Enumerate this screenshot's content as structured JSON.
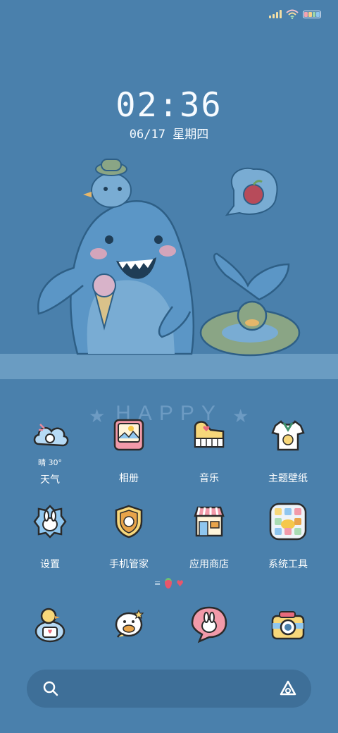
{
  "status_bar": {
    "icons": [
      "signal-icon",
      "wifi-icon",
      "battery-icon"
    ],
    "battery_colors": [
      "#f4a3b0",
      "#f6d08a",
      "#9fd6a8",
      "#8fc6ef"
    ]
  },
  "lockscreen": {
    "time": "02:36",
    "date": "06/17 星期四"
  },
  "wallpaper": {
    "text": "HAPPY",
    "background": "#4a80ac",
    "shark_color": "#5b96c6",
    "outline_color": "#2e5f86"
  },
  "apps": {
    "row1": [
      {
        "label": "天气",
        "icon": "weather-cloud-icon",
        "temp": "晴 30°"
      },
      {
        "label": "相册",
        "icon": "gallery-photo-icon"
      },
      {
        "label": "音乐",
        "icon": "music-piano-icon"
      },
      {
        "label": "主题壁纸",
        "icon": "theme-shirt-icon"
      }
    ],
    "row2": [
      {
        "label": "设置",
        "icon": "settings-bunny-icon"
      },
      {
        "label": "手机管家",
        "icon": "security-shield-icon"
      },
      {
        "label": "应用商店",
        "icon": "app-store-shop-icon"
      },
      {
        "label": "系统工具",
        "icon": "system-tools-folder-icon"
      }
    ],
    "dock": [
      {
        "icon": "phone-duck-icon"
      },
      {
        "icon": "messages-chick-icon"
      },
      {
        "icon": "contacts-bunny-bubble-icon"
      },
      {
        "icon": "camera-icon"
      }
    ]
  },
  "page_indicator": {
    "icons": [
      "menu-lines-icon",
      "strawberry-icon",
      "heart-icon"
    ]
  },
  "search": {
    "icons": [
      "search-icon",
      "assistant-icon"
    ]
  }
}
